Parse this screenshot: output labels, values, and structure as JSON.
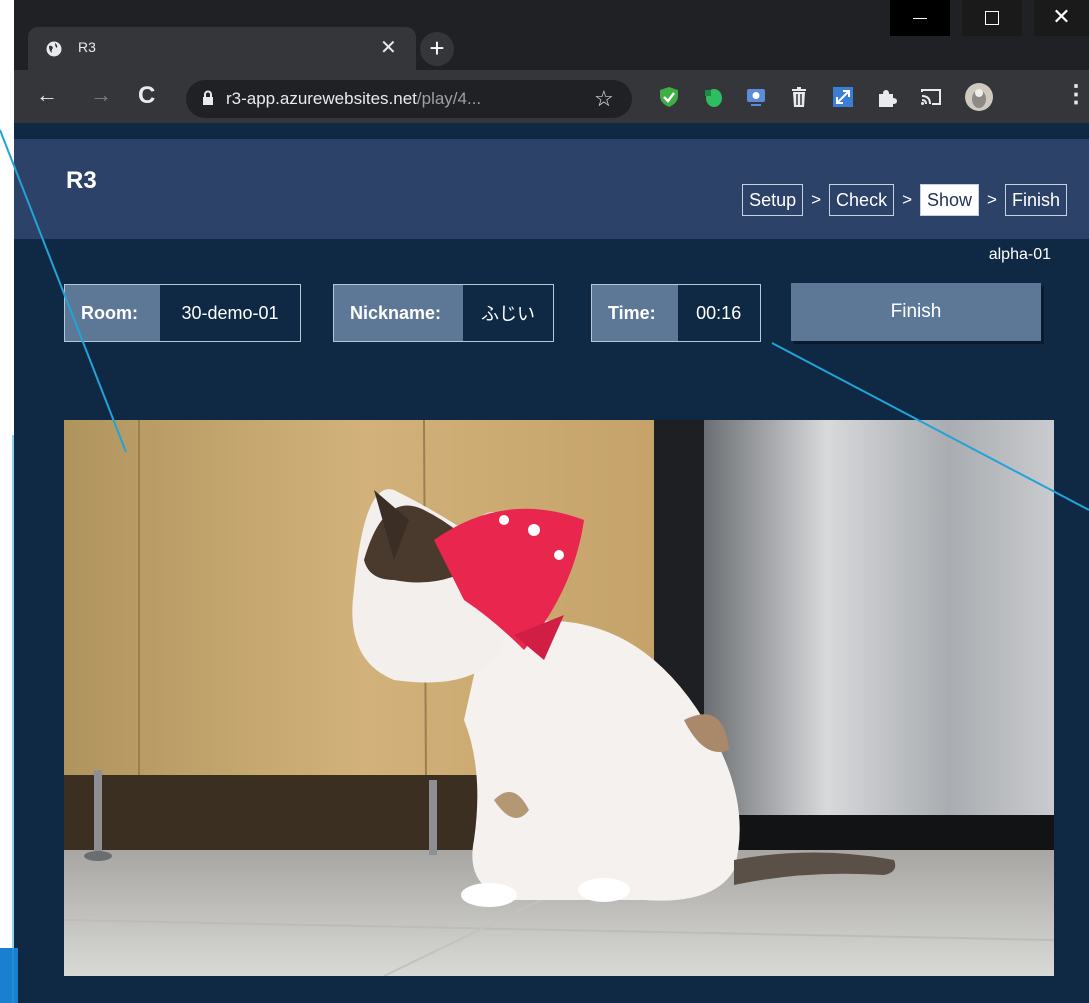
{
  "browser": {
    "tab_title": "R3",
    "url_host": "r3-app.azurewebsites.net",
    "url_path": "/play/4...",
    "extensions": [
      "shield-check-icon",
      "evernote-icon",
      "screen-icon",
      "trash-icon",
      "resize-icon",
      "puzzle-icon",
      "cast-icon",
      "profile-avatar",
      "more-menu-icon"
    ]
  },
  "app": {
    "logo": "R3",
    "steps": [
      {
        "label": "Setup",
        "active": false
      },
      {
        "label": "Check",
        "active": false
      },
      {
        "label": "Show",
        "active": true
      },
      {
        "label": "Finish",
        "active": false
      }
    ],
    "step_separator": ">",
    "user_id": "alpha-01",
    "room": {
      "label": "Room:",
      "value": "30-demo-01"
    },
    "nickname": {
      "label": "Nickname:",
      "value": "ふじい"
    },
    "time": {
      "label": "Time:",
      "value": "00:16"
    },
    "finish_button": "Finish"
  },
  "colors": {
    "header": "#2d4268",
    "background": "#0f2945",
    "label_bg": "#5d7896",
    "callout_line": "#22a3d8"
  }
}
